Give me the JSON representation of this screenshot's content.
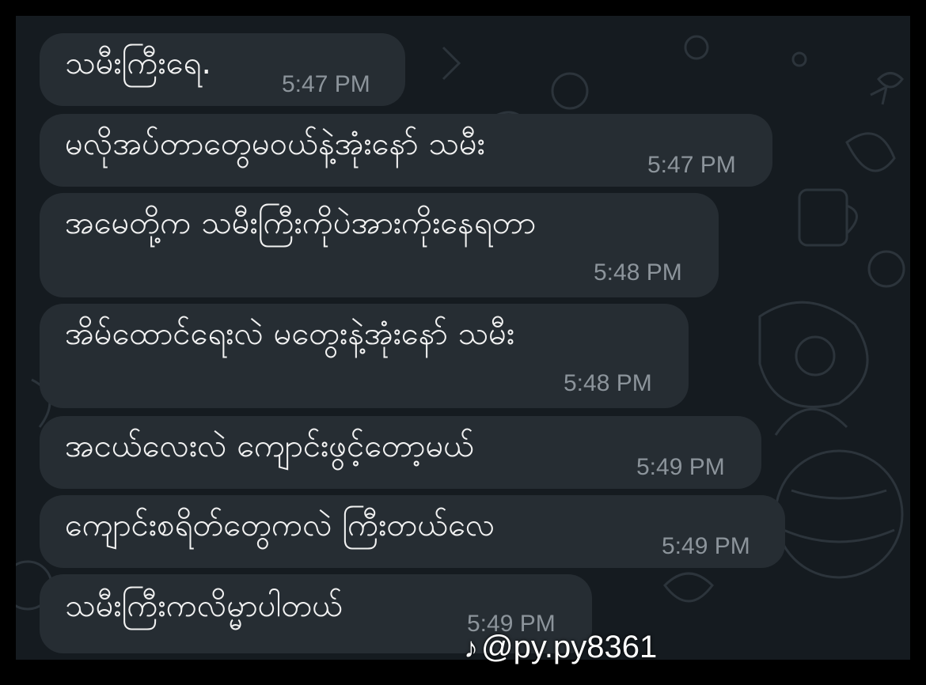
{
  "messages": [
    {
      "text": "သမီးကြီးရေ.",
      "time": "5:47 PM"
    },
    {
      "text": "မလိုအပ်တာတွေမဝယ်နဲ့အုံးနော် သမီး",
      "time": "5:47 PM"
    },
    {
      "text": "အမေတို့က သမီးကြီးကိုပဲအားကိုးနေရတာ",
      "time": "5:48 PM"
    },
    {
      "text": "အိမ်ထောင်ရေးလဲ မတွေးနဲ့အုံးနော် သမီး",
      "time": "5:48 PM"
    },
    {
      "text": "အငယ်လေးလဲ ကျောင်းဖွင့်တော့မယ်",
      "time": "5:49 PM"
    },
    {
      "text": "ကျောင်းစရိတ်တွေကလဲ ကြီးတယ်လေ",
      "time": "5:49 PM"
    },
    {
      "text": "သမီးကြီးကလိမ္မာပါတယ်",
      "time": "5:49 PM"
    }
  ],
  "watermark": {
    "icon": "tiktok-icon",
    "handle": "@py.py8361"
  },
  "colors": {
    "background": "#151b20",
    "bubble": "#262d33",
    "text": "#f2f2f2",
    "time": "#8c949b"
  }
}
